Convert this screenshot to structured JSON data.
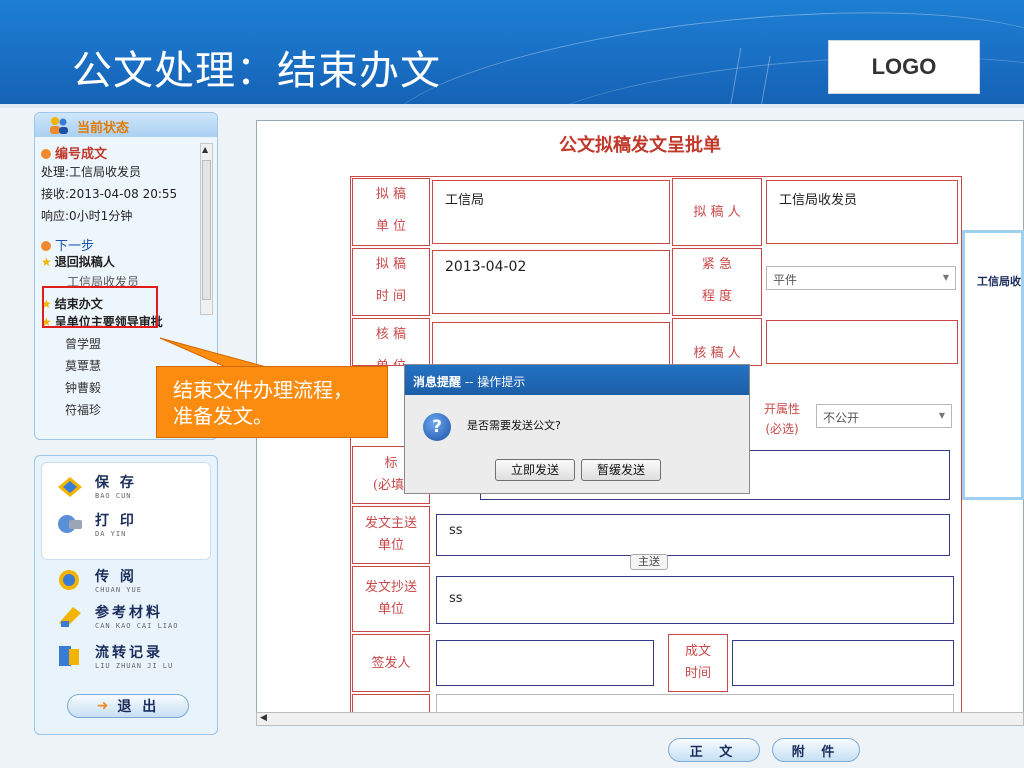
{
  "header": {
    "title": "公文处理：结束办文",
    "logo": "LOGO"
  },
  "status_panel": {
    "title": "当前状态",
    "current_step": "编号成文",
    "handler": "处理:工信局收发员",
    "received": "接收:2013-04-08 20:55",
    "response": "响应:0小时1分钟",
    "next_step_title": "下一步",
    "options": [
      {
        "label": "退回拟稿人",
        "people": [
          "工信局收发员"
        ]
      },
      {
        "label": "结束办文",
        "people": []
      },
      {
        "label": "呈单位主要领导审批",
        "people": [
          "曾学盟",
          "莫覃慧",
          "钟曹毅",
          "符福珍"
        ]
      }
    ]
  },
  "callout": {
    "line1": "结束文件办理流程，",
    "line2": "准备发文。"
  },
  "actions": [
    {
      "label": "保 存",
      "pinyin": "BAO CUN",
      "icon": "save-icon"
    },
    {
      "label": "打 印",
      "pinyin": "DA YIN",
      "icon": "print-icon"
    },
    {
      "label": "传 阅",
      "pinyin": "CHUAN YUE",
      "icon": "circulate-icon"
    },
    {
      "label": "参考材料",
      "pinyin": "CAN KAO CAI LIAO",
      "icon": "reference-icon"
    },
    {
      "label": "流转记录",
      "pinyin": "LIU ZHUAN JI LU",
      "icon": "record-icon"
    }
  ],
  "exit_label": "退 出",
  "doc": {
    "title": "公文拟稿发文呈批单",
    "labels": {
      "draft_unit": [
        "拟 稿",
        "单 位"
      ],
      "drafter": "拟 稿 人",
      "draft_time": [
        "拟 稿",
        "时 间"
      ],
      "urgency": [
        "紧 急",
        "程 度"
      ],
      "check_unit": [
        "核 稿",
        "单 位"
      ],
      "checker": "核 稿 人",
      "open_attr": [
        "开属性",
        "(必选)"
      ],
      "title_label": [
        "标",
        "(必填)"
      ],
      "main_send": [
        "发文主送",
        "单位"
      ],
      "cc": [
        "发文抄送",
        "单位"
      ],
      "signer": "签发人",
      "finish_time": [
        "成文",
        "时间"
      ]
    },
    "values": {
      "draft_unit": "工信局",
      "drafter": "工信局收发员",
      "draft_time": "2013-04-02",
      "urgency": "平件",
      "open_attr": "不公开",
      "main_send": "ss",
      "cc": "ss"
    },
    "zhusong_button": "主送",
    "side_text": "工信局收"
  },
  "dialog": {
    "title_bold": "消息提醒",
    "title_rest": " -- 操作提示",
    "message": "是否需要发送公文?",
    "buttons": [
      "立即发送",
      "暂缓发送"
    ]
  },
  "bottom_buttons": [
    "正 文",
    "附 件"
  ]
}
